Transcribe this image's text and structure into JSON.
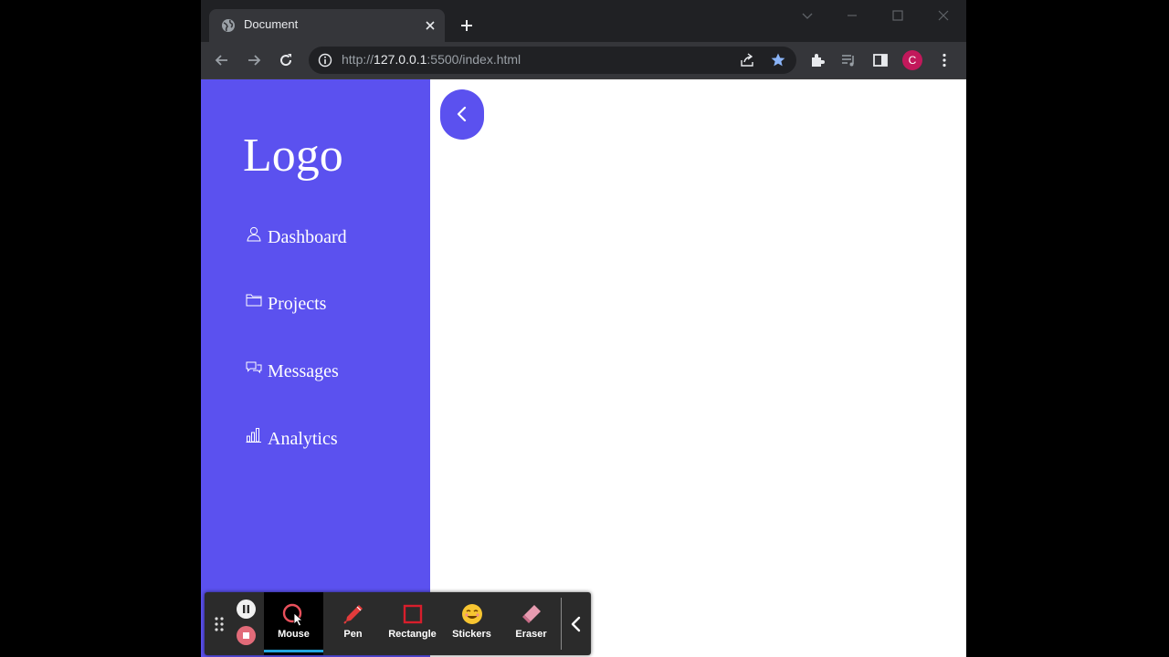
{
  "browser": {
    "tab_title": "Document",
    "url_scheme": "http://",
    "url_host": "127.0.0.1",
    "url_rest": ":5500/index.html",
    "profile_initial": "C",
    "accent_color": "#5b51ef"
  },
  "sidebar": {
    "logo": "Logo",
    "items": [
      {
        "label": "Dashboard",
        "icon": "user-icon"
      },
      {
        "label": "Projects",
        "icon": "folder-icon"
      },
      {
        "label": "Messages",
        "icon": "chat-icon"
      },
      {
        "label": "Analytics",
        "icon": "bar-chart-icon"
      }
    ]
  },
  "recorder": {
    "tools": [
      {
        "label": "Mouse",
        "icon": "mouse-cursor-icon",
        "active": true
      },
      {
        "label": "Pen",
        "icon": "pen-icon",
        "active": false
      },
      {
        "label": "Rectangle",
        "icon": "rectangle-icon",
        "active": false
      },
      {
        "label": "Stickers",
        "icon": "sticker-smiley-icon",
        "active": false
      },
      {
        "label": "Eraser",
        "icon": "eraser-icon",
        "active": false
      }
    ]
  }
}
